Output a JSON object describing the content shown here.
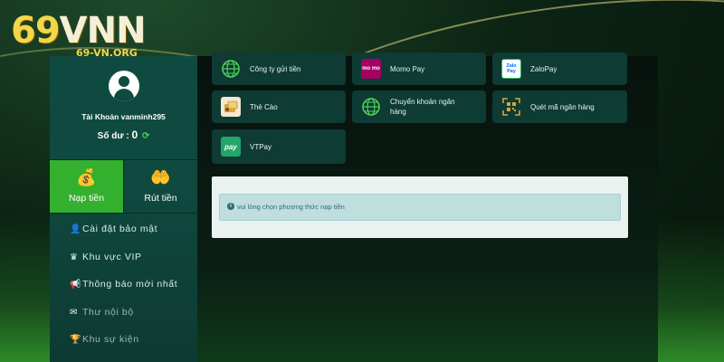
{
  "logo": {
    "main_a": "69",
    "main_b": "VNN",
    "sub": "69-VN.ORG"
  },
  "profile": {
    "account_label": "Tài Khoản vanminh295",
    "balance_label": "Số dư :",
    "balance_value": "0"
  },
  "tabs": [
    {
      "label": "Nạp tiền",
      "icon": "money-bag-icon",
      "active": true
    },
    {
      "label": "Rút tiền",
      "icon": "hand-money-icon",
      "active": false
    }
  ],
  "menu": [
    {
      "label": "Cài đặt bảo mật",
      "icon": "user-lock-icon"
    },
    {
      "label": "Khu vực VIP",
      "icon": "crown-icon"
    },
    {
      "label": "Thông báo mới nhất",
      "icon": "megaphone-icon"
    },
    {
      "label": "Thư nội bộ",
      "icon": "mail-icon"
    },
    {
      "label": "Khu sự kiện",
      "icon": "trophy-icon"
    }
  ],
  "payment_methods": [
    {
      "label": "Công ty gửi tiền",
      "icon": "globe-icon"
    },
    {
      "label": "Momo Pay",
      "icon": "momo-icon",
      "icon_text": "mo mo"
    },
    {
      "label": "ZaloPay",
      "icon": "zalopay-icon",
      "icon_text": "Zalo Pay"
    },
    {
      "label": "Thẻ Cào",
      "icon": "scratch-card-icon"
    },
    {
      "label": "Chuyển khoản ngân hàng",
      "icon": "globe-icon"
    },
    {
      "label": "Quét mã ngân hàng",
      "icon": "qr-scan-icon"
    },
    {
      "label": "VTPay",
      "icon": "vtpay-icon",
      "icon_text": "pay"
    }
  ],
  "notice": {
    "text": "vui lòng chọn phương thức nạp tiền"
  },
  "colors": {
    "accent_green": "#33b02e",
    "panel_teal": "#0f4a40",
    "logo_gold": "#f3d64a"
  }
}
